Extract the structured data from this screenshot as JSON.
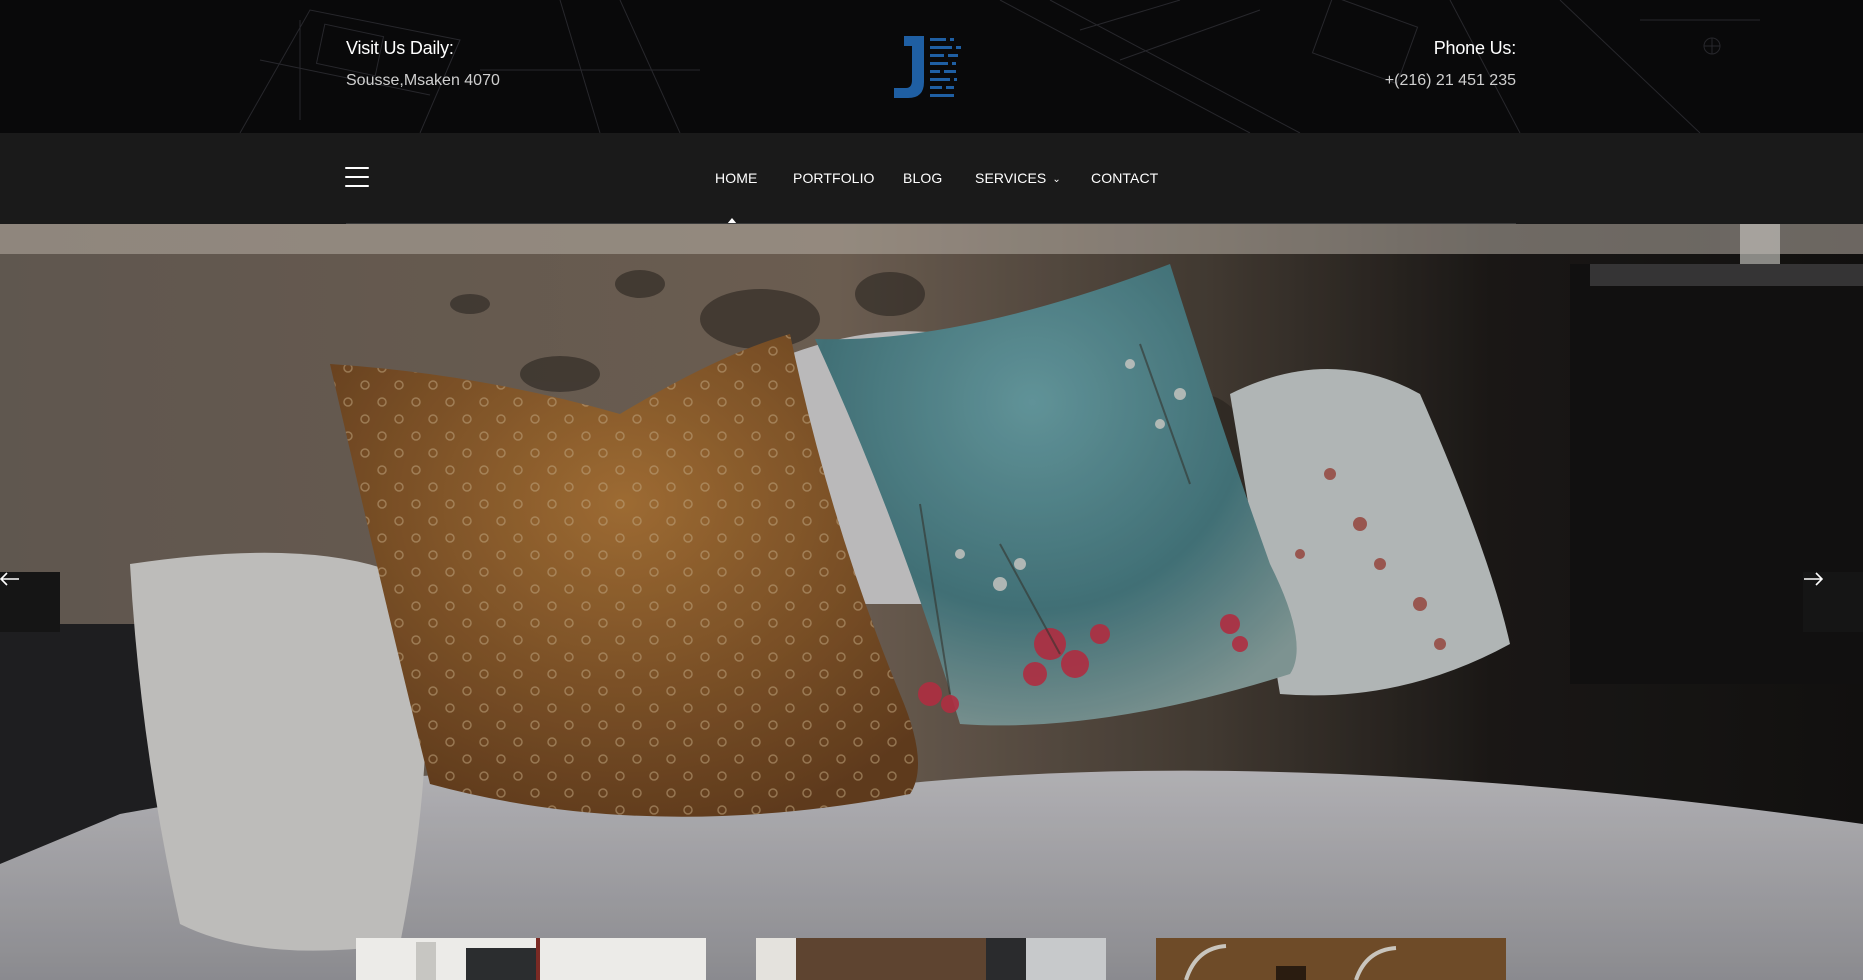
{
  "topbar": {
    "visit": {
      "title": "Visit Us Daily:",
      "text": "Sousse,Msaken 4070"
    },
    "phone": {
      "title": "Phone Us:",
      "text": "+(216) 21 451 235"
    }
  },
  "logo": {
    "icon": "j-logo-icon",
    "color": "#1f5fa3"
  },
  "nav": {
    "menu_icon": "hamburger-menu-icon",
    "items": [
      {
        "label": "HOME",
        "active": true
      },
      {
        "label": "PORTFOLIO",
        "active": false
      },
      {
        "label": "BLOG",
        "active": false
      },
      {
        "label": "SERVICES",
        "active": false,
        "dropdown": true
      },
      {
        "label": "CONTACT",
        "active": false
      }
    ]
  },
  "hero": {
    "image": "pillows-on-bed-photo",
    "prev_icon": "arrow-left-icon",
    "next_icon": "arrow-right-icon"
  },
  "thumbnails": [
    {
      "image": "interior-thumbnail-1"
    },
    {
      "image": "interior-thumbnail-2"
    },
    {
      "image": "interior-thumbnail-3"
    }
  ],
  "colors": {
    "topbar_bg": "#09090a",
    "navbar_bg": "#1a1a1a",
    "accent": "#1f5fa3"
  }
}
